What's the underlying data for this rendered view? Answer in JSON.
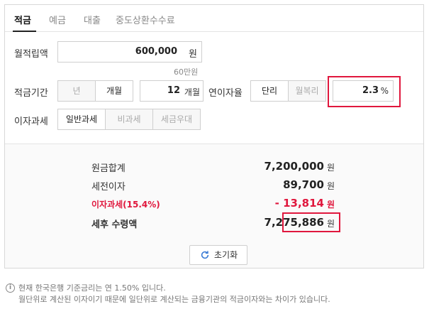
{
  "tabs": [
    {
      "label": "적금",
      "active": true
    },
    {
      "label": "예금",
      "active": false
    },
    {
      "label": "대출",
      "active": false
    },
    {
      "label": "중도상환수수료",
      "active": false
    }
  ],
  "form": {
    "monthly_label": "월적립액",
    "monthly_value": "600,000",
    "monthly_unit": "원",
    "monthly_hint": "60만원",
    "period_label": "적금기간",
    "period_options": [
      "년",
      "개월"
    ],
    "period_selected": "개월",
    "period_value": "12",
    "period_unit": "개월",
    "rate_label": "연이자율",
    "rate_options": [
      "단리",
      "월복리"
    ],
    "rate_selected": "단리",
    "rate_value": "2.3",
    "rate_unit": "%",
    "tax_label": "이자과세",
    "tax_options": [
      "일반과세",
      "비과세",
      "세금우대"
    ],
    "tax_selected": "일반과세"
  },
  "results": {
    "principal_label": "원금합계",
    "principal_value": "7,200,000",
    "pretax_label": "세전이자",
    "pretax_value": "89,700",
    "tax_label": "이자과세(15.4%)",
    "tax_value": "- 13,814",
    "net_label": "세후 수령액",
    "net_value": "7,275,886",
    "unit": "원"
  },
  "reset_label": "초기화",
  "footer": {
    "line1": "현재 한국은행 기준금리는 연 1.50% 입니다.",
    "line2": "월단위로 계산된 이자이기 때문에 일단위로 계산되는 금융기관의 적금이자와는 차이가 있습니다."
  },
  "colors": {
    "highlight": "#e0173d"
  }
}
